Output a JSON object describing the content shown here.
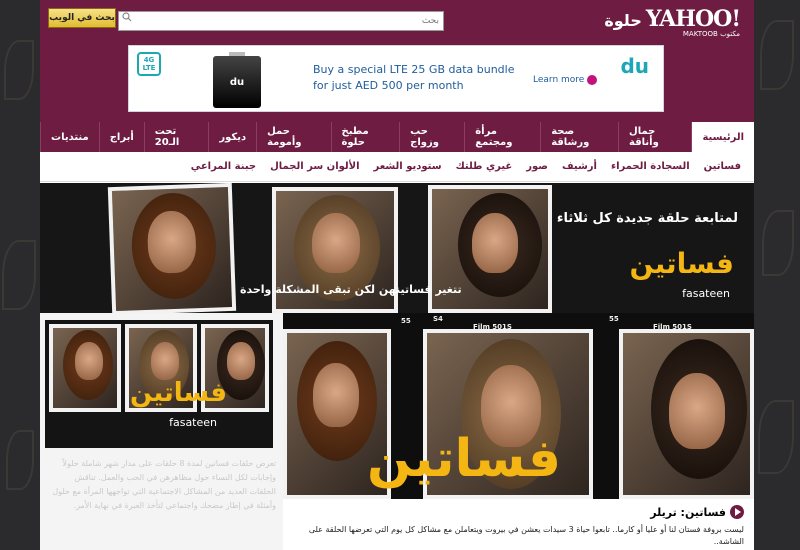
{
  "header": {
    "logo_brand": "YAHOO!",
    "logo_brand_ar": "حلوة",
    "logo_sub": "MAKTOOB مكتوب",
    "search": {
      "button_label": "بحث في الويب",
      "placeholder": "بحث"
    }
  },
  "ad": {
    "lte_badge": "4G LTE",
    "dongle_label": "du",
    "line1": "Buy a special LTE 25 GB data bundle",
    "line2": "for just AED 500 per month",
    "learn_more": "Learn more",
    "brand": "du"
  },
  "nav_primary": [
    {
      "label": "الرئيسية",
      "active": true
    },
    {
      "label": "جمال وأناقة"
    },
    {
      "label": "صحة ورشاقة"
    },
    {
      "label": "مرأة ومجتمع"
    },
    {
      "label": "حب وزواج"
    },
    {
      "label": "مطبخ حلوة"
    },
    {
      "label": "حمل وأمومة"
    },
    {
      "label": "ديكور"
    },
    {
      "label": "تحت الـ20"
    },
    {
      "label": "أبراج"
    },
    {
      "label": "منتديات"
    }
  ],
  "nav_secondary": [
    {
      "label": "فساتين"
    },
    {
      "label": "السجادة الحمراء"
    },
    {
      "label": "أرشيف"
    },
    {
      "label": "صور"
    },
    {
      "label": "غيري طلتك"
    },
    {
      "label": "ستوديو الشعر"
    },
    {
      "label": "الألوان سر الجمال"
    },
    {
      "label": "جبنة المراعي"
    }
  ],
  "banner": {
    "subtitle": "لمتابعة حلقة جديدة كل ثلاثاء",
    "logo_ar": "فساتين",
    "logo_en": "fasateen",
    "tagline": "تتغير فساتينهن لكن تبقى المشكلة واحدة"
  },
  "side": {
    "thumb_logo_ar": "فساتين",
    "thumb_logo_en": "fasateen",
    "description": "تعرض حلقات فساتين لمدة 8 حلقات على مدار شهر شاملة حلولاً وإجابات لكل النساء حول مظاهرهن في الحب والعمل. تناقش الحلقات العديد من المشاكل الاجتماعية التي تواجهها المرأة مع حلول وأمثلة في إطار مضحك واجتماعي لتأخذ العبرة في نهاية الأمر."
  },
  "video": {
    "film_labels": [
      "55",
      "S4",
      "Film 501S",
      "55",
      "Film 501S"
    ],
    "logo_ar": "فساتين"
  },
  "caption": {
    "title": "فساتين: تريلر",
    "text": "ليست بروفة فستان لنا أو عليا أو كارما.. تابعوا حياة 3 سيدات يعشن في بيروت ويتعاملن مع مشاكل كل يوم التي تعرضها الحلقة على الشاشة.."
  }
}
